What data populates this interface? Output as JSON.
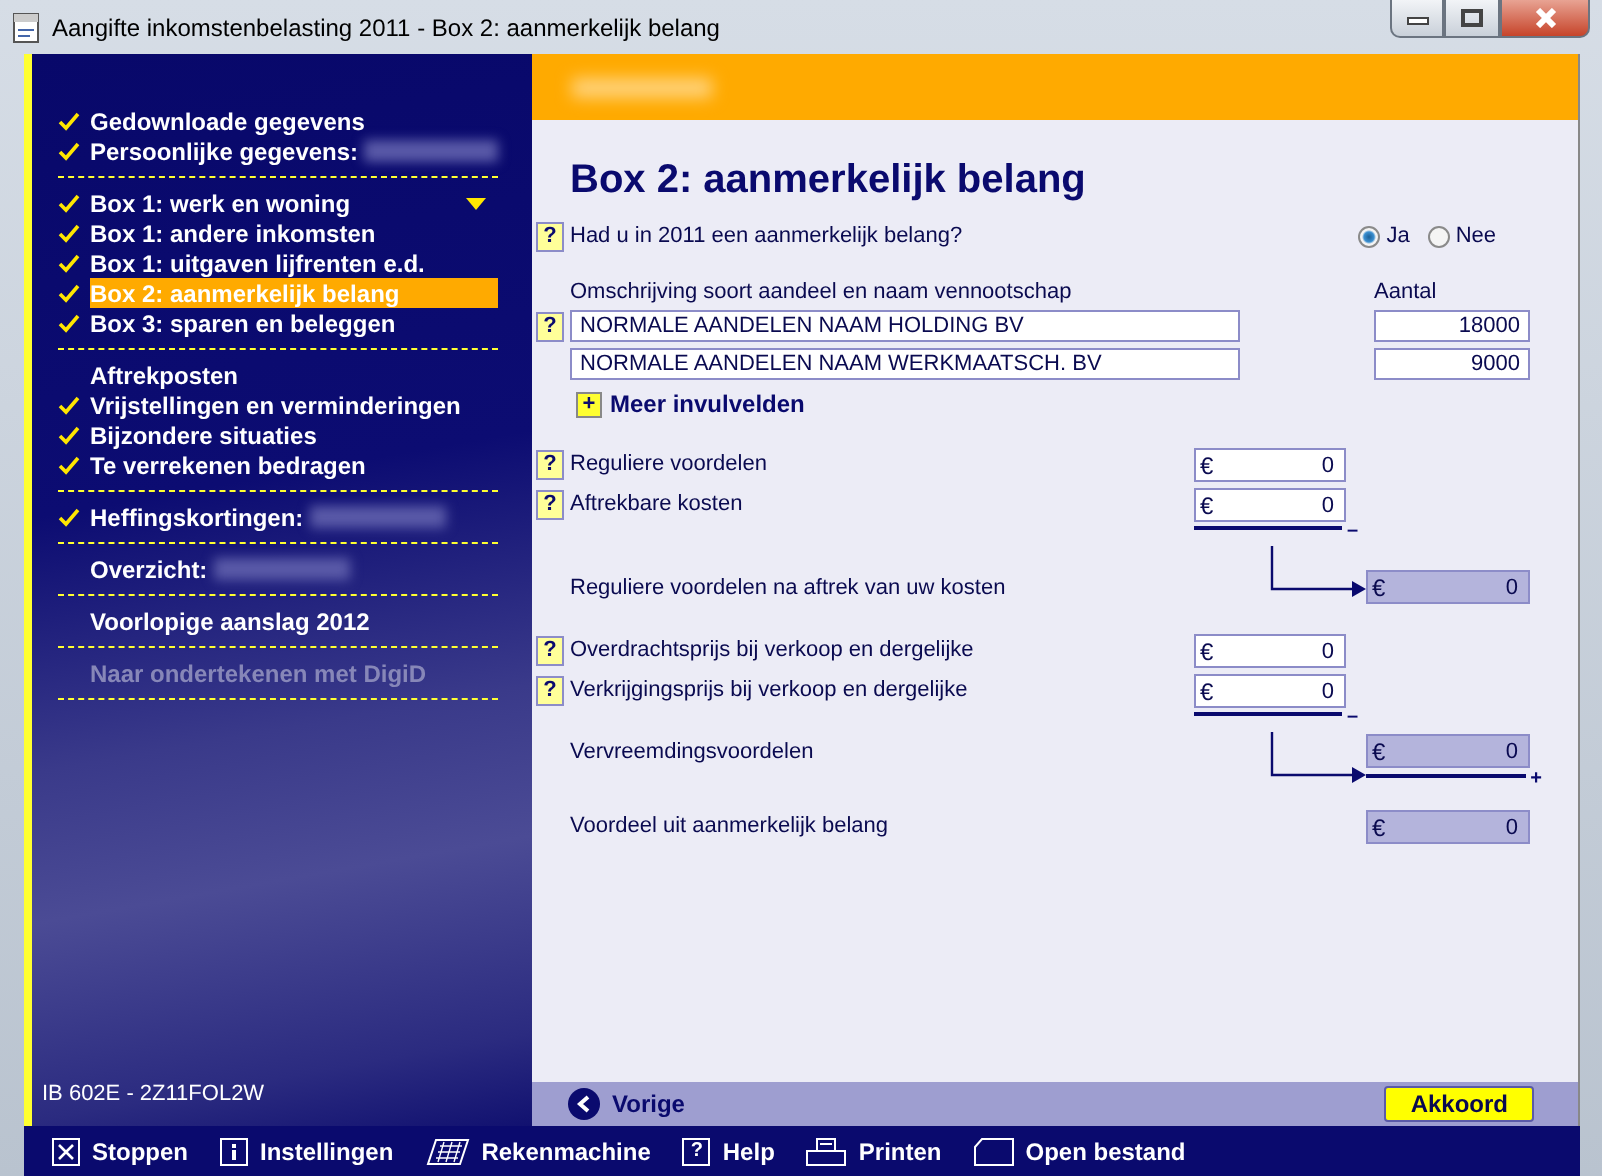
{
  "window": {
    "title": "Aangifte inkomstenbelasting 2011 - Box 2: aanmerkelijk belang"
  },
  "sidebar": {
    "groups": [
      {
        "items": [
          {
            "label": "Gedownloade gegevens",
            "checked": true,
            "selected": false,
            "disabled": false,
            "blurred": false,
            "dropdown": false
          },
          {
            "label": "Persoonlijke gegevens:",
            "checked": true,
            "selected": false,
            "disabled": false,
            "blurred": true,
            "dropdown": false
          }
        ]
      },
      {
        "items": [
          {
            "label": "Box 1: werk en woning",
            "checked": true,
            "selected": false,
            "disabled": false,
            "blurred": false,
            "dropdown": true
          },
          {
            "label": "Box 1: andere inkomsten",
            "checked": true,
            "selected": false,
            "disabled": false,
            "blurred": false,
            "dropdown": false
          },
          {
            "label": "Box 1: uitgaven lijfrenten e.d.",
            "checked": true,
            "selected": false,
            "disabled": false,
            "blurred": false,
            "dropdown": false
          },
          {
            "label": "Box 2: aanmerkelijk belang",
            "checked": true,
            "selected": true,
            "disabled": false,
            "blurred": false,
            "dropdown": false
          },
          {
            "label": "Box 3: sparen en beleggen",
            "checked": true,
            "selected": false,
            "disabled": false,
            "blurred": false,
            "dropdown": false
          }
        ]
      },
      {
        "items": [
          {
            "label": "Aftrekposten",
            "checked": false,
            "selected": false,
            "disabled": false,
            "blurred": false,
            "dropdown": false
          },
          {
            "label": "Vrijstellingen en verminderingen",
            "checked": true,
            "selected": false,
            "disabled": false,
            "blurred": false,
            "dropdown": false
          },
          {
            "label": "Bijzondere situaties",
            "checked": true,
            "selected": false,
            "disabled": false,
            "blurred": false,
            "dropdown": false
          },
          {
            "label": "Te verrekenen bedragen",
            "checked": true,
            "selected": false,
            "disabled": false,
            "blurred": false,
            "dropdown": false
          }
        ]
      },
      {
        "items": [
          {
            "label": "Heffingskortingen:",
            "checked": true,
            "selected": false,
            "disabled": false,
            "blurred": true,
            "dropdown": false
          }
        ]
      },
      {
        "items": [
          {
            "label": "Overzicht:",
            "checked": false,
            "selected": false,
            "disabled": false,
            "blurred": true,
            "dropdown": false
          }
        ]
      },
      {
        "items": [
          {
            "label": "Voorlopige aanslag 2012",
            "checked": false,
            "selected": false,
            "disabled": false,
            "blurred": false,
            "dropdown": false
          }
        ]
      },
      {
        "items": [
          {
            "label": "Naar ondertekenen met DigiD",
            "checked": false,
            "selected": false,
            "disabled": true,
            "blurred": false,
            "dropdown": false
          }
        ]
      }
    ],
    "footer": "IB 602E - 2Z11FOL2W"
  },
  "page": {
    "title": "Box 2: aanmerkelijk belang",
    "question": {
      "help": "?",
      "text": "Had u in 2011 een aanmerkelijk belang?",
      "options": [
        {
          "label": "Ja",
          "selected": true
        },
        {
          "label": "Nee",
          "selected": false
        }
      ]
    },
    "shares": {
      "columns": [
        "Omschrijving soort aandeel en naam vennootschap",
        "Aantal"
      ],
      "rows": [
        {
          "help": "?",
          "name": "NORMALE AANDELEN NAAM HOLDING BV",
          "count": "18000"
        },
        {
          "name": "NORMALE AANDELEN NAAM WERKMAATSCH. BV",
          "count": "9000"
        }
      ],
      "more": {
        "icon": "+",
        "label": "Meer invulvelden"
      }
    },
    "sections": [
      {
        "rows": [
          {
            "kind": "input",
            "help": "?",
            "label": "Reguliere voordelen",
            "currency": "€",
            "value": "0"
          },
          {
            "kind": "input",
            "help": "?",
            "label": "Aftrekbare kosten",
            "currency": "€",
            "value": "0",
            "operator": "–"
          },
          {
            "kind": "result",
            "label": "Reguliere voordelen na aftrek van uw kosten",
            "currency": "€",
            "value": "0"
          }
        ]
      },
      {
        "rows": [
          {
            "kind": "input",
            "help": "?",
            "label": "Overdrachtsprijs bij verkoop en dergelijke",
            "currency": "€",
            "value": "0"
          },
          {
            "kind": "input",
            "help": "?",
            "label": "Verkrijgingsprijs bij verkoop en dergelijke",
            "currency": "€",
            "value": "0",
            "operator": "–"
          },
          {
            "kind": "result",
            "label": "Vervreemdingsvoordelen",
            "currency": "€",
            "value": "0",
            "operator": "+"
          },
          {
            "kind": "total",
            "label": "Voordeel uit aanmerkelijk belang",
            "currency": "€",
            "value": "0"
          }
        ]
      }
    ]
  },
  "nav": {
    "back": "Vorige",
    "next": "Akkoord"
  },
  "toolbar": [
    {
      "label": "Stoppen"
    },
    {
      "label": "Instellingen"
    },
    {
      "label": "Rekenmachine"
    },
    {
      "glyph": "?",
      "label": "Help"
    },
    {
      "label": "Printen"
    },
    {
      "label": "Open bestand"
    }
  ]
}
